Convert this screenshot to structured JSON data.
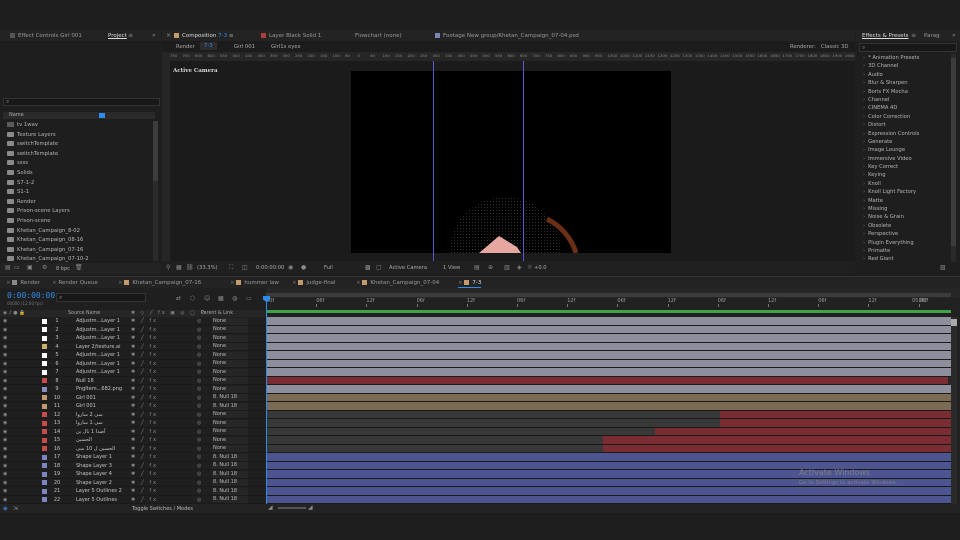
{
  "colors": {
    "accent": "#2d8ceb",
    "gray_bar": "#8e8f9c",
    "red_bar": "#7a2c33",
    "tan_bar": "#7b6b55",
    "dark_bar": "#383838",
    "blue_bar": "#4d5591",
    "green_bar": "#3fa447"
  },
  "left_panel": {
    "tabs": [
      "Effect Controls Girl 001",
      "Project"
    ],
    "list_header": "Name",
    "footer_bpc": "8 bpc",
    "items": [
      {
        "label": "tv 1wav",
        "type": "file"
      },
      {
        "label": "Texture Layers",
        "type": "folder"
      },
      {
        "label": "switchTemplate",
        "type": "folder"
      },
      {
        "label": "switchTemplate",
        "type": "folder"
      },
      {
        "label": "ssss",
        "type": "folder"
      },
      {
        "label": "Solids",
        "type": "folder"
      },
      {
        "label": "S7-1-2",
        "type": "folder"
      },
      {
        "label": "S1-1",
        "type": "folder"
      },
      {
        "label": "Render",
        "type": "folder"
      },
      {
        "label": "Prison-scene Layers",
        "type": "folder"
      },
      {
        "label": "Prison-scene",
        "type": "folder"
      },
      {
        "label": "Khetan_Campaign_8-02",
        "type": "folder"
      },
      {
        "label": "Khetan_Campaign_08-16",
        "type": "folder"
      },
      {
        "label": "Khetan_Campaign_07-16",
        "type": "folder"
      },
      {
        "label": "Khetan_Campaign_07-10-2",
        "type": "folder"
      }
    ]
  },
  "viewer": {
    "tabs": [
      {
        "label": "Composition",
        "sub": "7-3",
        "color": "#c49a6c"
      },
      {
        "label": "Layer Black Solid 1",
        "sub": "",
        "color": "#b03c3c"
      },
      {
        "label": "Flowchart (none)",
        "sub": "",
        "color": ""
      },
      {
        "label": "Footage New group/Khetan_Campaign_07-04.psd",
        "sub": "",
        "color": "#7a86b8"
      }
    ],
    "crumbs": [
      "Render",
      "7-3",
      "Girl 001",
      "Girl1s eyes"
    ],
    "renderer_label": "Renderer:",
    "renderer_value": "Classic 3D",
    "active_camera": "Active Camera",
    "footer": {
      "zoom": "(33.3%)",
      "timecode": "0:00:00:00",
      "res": "Full",
      "camera": "Active Camera",
      "view": "1 View",
      "offset": "+0.0"
    },
    "ruler": [
      "750",
      "700",
      "650",
      "600",
      "550",
      "500",
      "450",
      "400",
      "350",
      "300",
      "250",
      "200",
      "150",
      "100",
      "50",
      "0",
      "50",
      "100",
      "150",
      "200",
      "250",
      "300",
      "350",
      "400",
      "450",
      "500",
      "550",
      "600",
      "650",
      "700",
      "750",
      "800",
      "850",
      "900",
      "950",
      "1000",
      "1050",
      "1100",
      "1150",
      "1200",
      "1250",
      "1300",
      "1350",
      "1400",
      "1450",
      "1500",
      "1550",
      "1600",
      "1650",
      "1700",
      "1750",
      "1800",
      "1850",
      "1900",
      "1950",
      "2000"
    ]
  },
  "right_panel": {
    "tabs": [
      "Effects & Presets",
      "Parag"
    ],
    "items": [
      "* Animation Presets",
      "3D Channel",
      "Audio",
      "Blur & Sharpen",
      "Boris FX Mocha",
      "Channel",
      "CINEMA 4D",
      "Color Correction",
      "Distort",
      "Expression Controls",
      "Generate",
      "Image Lounge",
      "Immersive Video",
      "Key Correct",
      "Keying",
      "Knoll",
      "Knoll Light Factory",
      "Matte",
      "Missing",
      "Noise & Grain",
      "Obsolete",
      "Perspective",
      "Plugin Everything",
      "Primatte",
      "Red Giant"
    ]
  },
  "timeline": {
    "tabs": [
      {
        "label": "Render",
        "color": "#8a8a8a"
      },
      {
        "label": "Render Queue",
        "color": ""
      },
      {
        "label": "Khetan_Campaign_07-16",
        "color": "#c49a6c"
      },
      {
        "label": "hummer law",
        "color": "#c49a6c"
      },
      {
        "label": "judge-final",
        "color": "#c49a6c"
      },
      {
        "label": "Khetan_Campaign_07-04",
        "color": "#c49a6c"
      },
      {
        "label": "7-3",
        "color": "#c49a6c"
      }
    ],
    "timecode": "0:00:00:00",
    "fps": "00000 (12.00 fps)",
    "col_source": "Source Name",
    "col_parent": "Parent & Link",
    "ruler": [
      "00f",
      "06f",
      "12f",
      "06f",
      "12f",
      "06f",
      "12f",
      "06f",
      "12f",
      "06f",
      "12f",
      "06f",
      "12f",
      "06f"
    ],
    "ruler_last": "05:00f",
    "footer": "Toggle Switches / Modes",
    "watermark_title": "Activate Windows",
    "watermark_sub": "Go to Settings to activate Windows.",
    "layers": [
      {
        "n": "1",
        "name": "Adjustm...Layer 1",
        "lbl": "#ffffff",
        "parent": "None",
        "type": "gray",
        "start": 0,
        "end": 1
      },
      {
        "n": "2",
        "name": "Adjustm...Layer 1",
        "lbl": "#ffffff",
        "parent": "None",
        "type": "gray",
        "start": 0,
        "end": 1
      },
      {
        "n": "3",
        "name": "Adjustm...Layer 1",
        "lbl": "#ffffff",
        "parent": "None",
        "type": "gray",
        "start": 0,
        "end": 1
      },
      {
        "n": "4",
        "name": "Layer 2/texture.ai",
        "lbl": "#c9b063",
        "parent": "None",
        "type": "gray",
        "start": 0,
        "end": 1
      },
      {
        "n": "5",
        "name": "Adjustm...Layer 1",
        "lbl": "#ffffff",
        "parent": "None",
        "type": "gray",
        "start": 0,
        "end": 1
      },
      {
        "n": "6",
        "name": "Adjustm...Layer 1",
        "lbl": "#ffffff",
        "parent": "None",
        "type": "gray",
        "start": 0,
        "end": 1
      },
      {
        "n": "7",
        "name": "Adjustm...Layer 1",
        "lbl": "#ffffff",
        "parent": "None",
        "type": "gray",
        "start": 0,
        "end": 1
      },
      {
        "n": "8",
        "name": "Null 18",
        "lbl": "#c84a4a",
        "parent": "None",
        "type": "red",
        "start": 0,
        "end": 0.995
      },
      {
        "n": "9",
        "name": "PngItem...682.png",
        "lbl": "#8a8fc2",
        "parent": "None",
        "type": "gray",
        "start": 0,
        "end": 1
      },
      {
        "n": "10",
        "name": "Girl 001",
        "lbl": "#c49a6c",
        "parent": "8. Null 18",
        "type": "tan",
        "start": 0,
        "end": 1
      },
      {
        "n": "11",
        "name": "Girl 001",
        "lbl": "#c49a6c",
        "parent": "8. Null 18",
        "type": "tan",
        "start": 0,
        "end": 1
      },
      {
        "n": "12",
        "name": "سی 2 ساروا",
        "lbl": "#c84a4a",
        "parent": "None",
        "type": "split",
        "start": 0,
        "end": 1,
        "split": 0.663
      },
      {
        "n": "13",
        "name": "سی 1 ساروا",
        "lbl": "#c84a4a",
        "parent": "None",
        "type": "split",
        "start": 0,
        "end": 1,
        "split": 0.663
      },
      {
        "n": "14",
        "name": "آصدا 1 نال ین",
        "lbl": "#c84a4a",
        "parent": "None",
        "type": "split",
        "start": 0,
        "end": 1,
        "split": 0.568
      },
      {
        "n": "15",
        "name": "الحسين",
        "lbl": "#c84a4a",
        "parent": "None",
        "type": "split",
        "start": 0,
        "end": 1,
        "split": 0.492
      },
      {
        "n": "16",
        "name": "الحسین ل 10 سی",
        "lbl": "#c84a4a",
        "parent": "None",
        "type": "split",
        "start": 0,
        "end": 1,
        "split": 0.492
      },
      {
        "n": "17",
        "name": "Shape Layer 1",
        "lbl": "#7b85c4",
        "parent": "8. Null 18",
        "type": "blue",
        "start": 0,
        "end": 1
      },
      {
        "n": "18",
        "name": "Shape Layer 3",
        "lbl": "#7b85c4",
        "parent": "8. Null 18",
        "type": "blue",
        "start": 0,
        "end": 1
      },
      {
        "n": "19",
        "name": "Shape Layer 4",
        "lbl": "#7b85c4",
        "parent": "8. Null 18",
        "type": "blue",
        "start": 0,
        "end": 1
      },
      {
        "n": "20",
        "name": "Shape Layer 2",
        "lbl": "#7b85c4",
        "parent": "8. Null 18",
        "type": "blue",
        "start": 0,
        "end": 1
      },
      {
        "n": "21",
        "name": "Layer 5 Outlines 2",
        "lbl": "#7b85c4",
        "parent": "8. Null 18",
        "type": "blue",
        "start": 0,
        "end": 1
      },
      {
        "n": "22",
        "name": "Layer 5 Outlines",
        "lbl": "#7b85c4",
        "parent": "8. Null 18",
        "type": "blue",
        "start": 0,
        "end": 1
      }
    ]
  }
}
